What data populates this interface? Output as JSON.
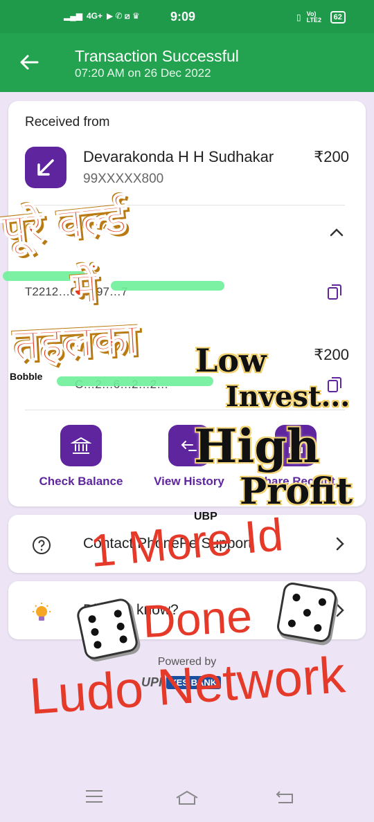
{
  "status_bar": {
    "time": "9:09",
    "network": "4G+",
    "volte": "Vo) LTE2",
    "battery": "62"
  },
  "header": {
    "title": "Transaction Successful",
    "subtitle": "07:20 AM on 26 Dec 2022"
  },
  "transaction": {
    "received_label": "Received from",
    "payer_name": "Devarakonda H H Sudhakar",
    "payer_phone": "99XXXXX800",
    "amount": "₹200",
    "detail_amount": "₹200",
    "detail_line1": "T2212…068897…7",
    "detail_line2": "C…2…6…2…2…"
  },
  "actions": [
    {
      "label": "Check Balance"
    },
    {
      "label": "View History"
    },
    {
      "label": "Share Receipt"
    }
  ],
  "support": {
    "label": "Contact PhonePe Support"
  },
  "did_you_know": {
    "label": "Did you know?"
  },
  "footer": {
    "powered_by": "Powered by",
    "upi": "UPI",
    "bank": "YES BANK"
  },
  "overlays": {
    "hindi_line1": "पूरे वर्ल्ड",
    "hindi_line2": "में",
    "hindi_line3": "तहलका",
    "bubble_tag": "Bobble",
    "low": "Low",
    "invest": "Invest...",
    "high": "High",
    "profit": "Profit",
    "ubp": "UBP",
    "more_id": "1 More Id",
    "done": "Done",
    "ludo": "Ludo Network"
  },
  "colors": {
    "header_green": "#23a34f",
    "accent_purple": "#5f259f",
    "background": "#ede5f5"
  }
}
